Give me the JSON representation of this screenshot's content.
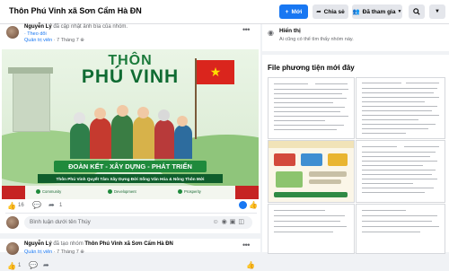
{
  "header": {
    "group_title": "Thôn Phú Vinh xã Sơn Cẩm Hà ĐN",
    "new_button": "Mới",
    "share_button": "Chia sẻ",
    "joined_button": "Đã tham gia"
  },
  "post1": {
    "author": "Nguyễn Lý",
    "action": "đã cập nhật ảnh bìa của nhóm.",
    "follow": "Theo dõi",
    "role": "Quản trị viên",
    "time": "7 Tháng 7"
  },
  "banner": {
    "title_top": "THÔN",
    "title_main": "PHÚ VINH",
    "slogan": "ĐOÀN KẾT - XÂY DỰNG - PHÁT TRIỂN",
    "subtitle": "Thôn Phú Vinh Quyết Tâm Xây Dựng Đời Sống Văn Hóa & Nông Thôn Mới",
    "tags": [
      "Community",
      "Development",
      "Prosperity"
    ]
  },
  "stats": {
    "likes": "16",
    "shares": "1"
  },
  "comment": {
    "placeholder": "Bình luận dưới tên Thúy"
  },
  "post2": {
    "author": "Nguyễn Lý",
    "action": "đã tạo nhóm",
    "group": "Thôn Phú Vinh xã Sơn Cẩm Hà ĐN",
    "role": "Quản trị viên",
    "time": "7 Tháng 7",
    "likes": "1"
  },
  "sidebar": {
    "visibility_title": "Hiển thị",
    "visibility_desc": "Ai cũng có thể tìm thấy nhóm này.",
    "media_title": "File phương tiện mới đây"
  },
  "colors": {
    "accent": "#1877f2",
    "banner_green": "#1f8a3c",
    "flag_red": "#da251d"
  }
}
